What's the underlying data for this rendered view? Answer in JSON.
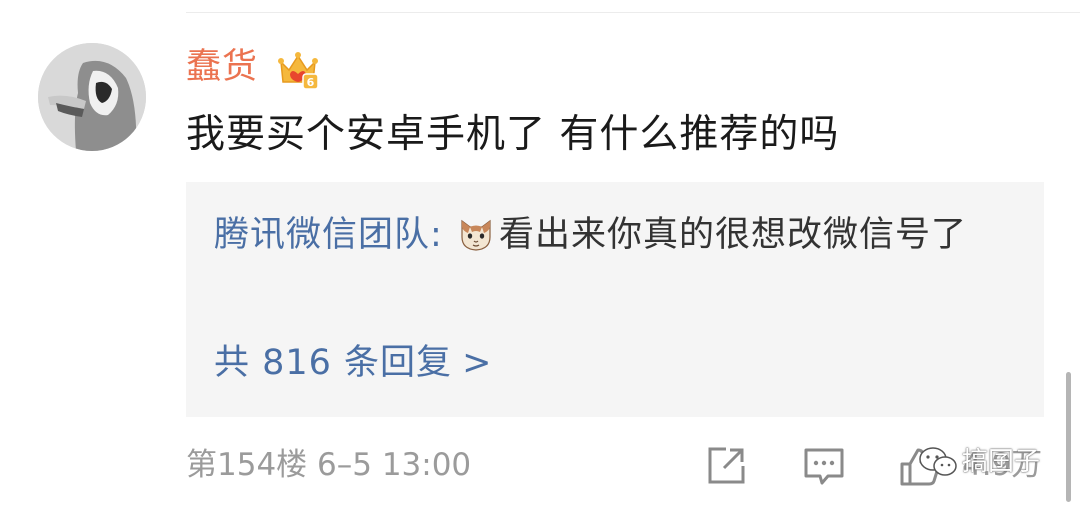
{
  "comment": {
    "username": "蠢货",
    "text": "我要买个安卓手机了 有什么推荐的吗",
    "vip_level": "6"
  },
  "reply": {
    "author": "腾讯微信团队:",
    "emoji": "cat-emoji",
    "text": "看出来你真的很想改微信号了",
    "more_label": "共 816 条回复",
    "more_chevron": ">"
  },
  "footer": {
    "floor_and_time": "第154楼  6–5 13:00",
    "like_count": "4.9万"
  },
  "watermark": {
    "text": "搞囝子"
  },
  "colors": {
    "username": "#eb7350",
    "link_blue": "#4a6fa5",
    "reply_bg": "#f5f5f5",
    "meta_gray": "#9b9b9b"
  },
  "icons": [
    "share-icon",
    "comment-icon",
    "like-icon",
    "vip-crown-icon",
    "cat-emoji",
    "wechat-watermark-icon"
  ]
}
